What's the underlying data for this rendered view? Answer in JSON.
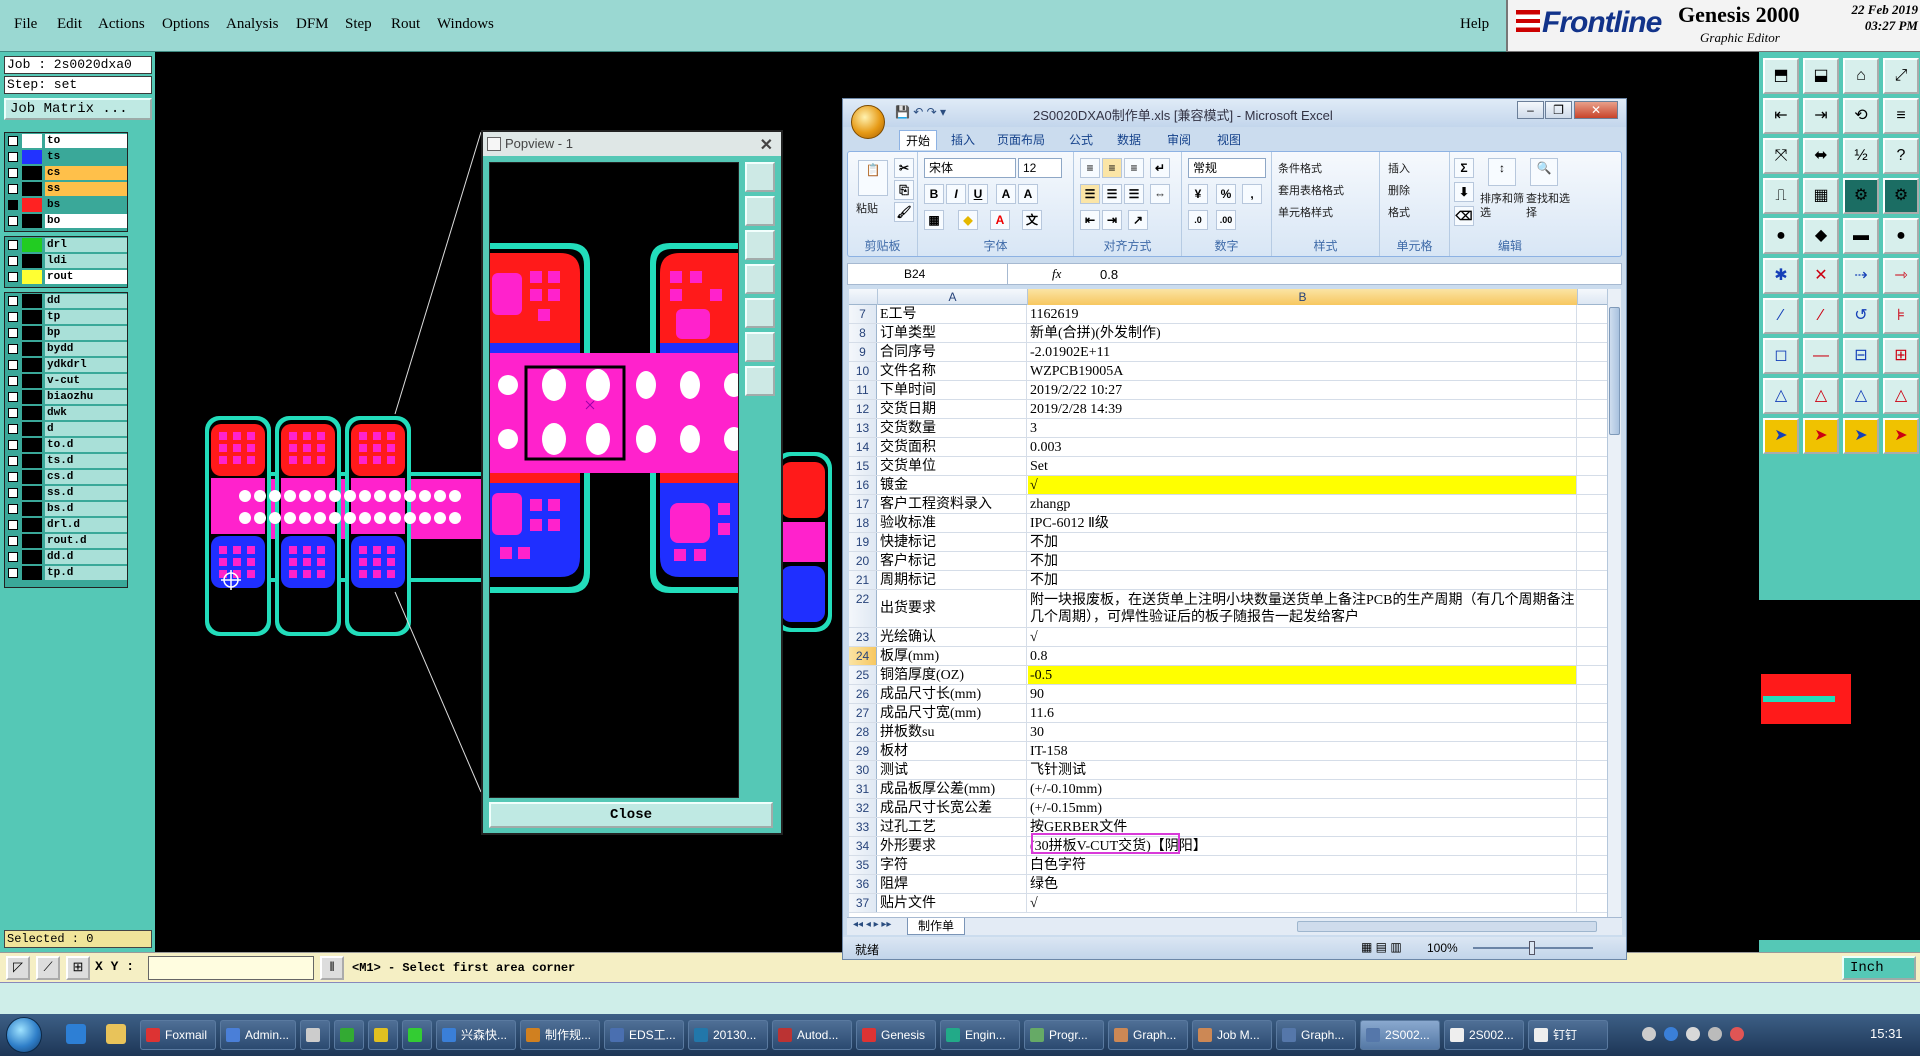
{
  "menubar": {
    "items": [
      "File",
      "Edit",
      "Actions",
      "Options",
      "Analysis",
      "DFM",
      "Step",
      "Rout",
      "Windows"
    ],
    "help": "Help"
  },
  "logo": {
    "brand": "Frontline",
    "product": "Genesis 2000",
    "subtitle": "Graphic Editor",
    "date": "22 Feb 2019",
    "time": "03:27 PM"
  },
  "leftpanel": {
    "job": "Job : 2s0020dxa0",
    "step": "Step: set",
    "job_matrix": "Job Matrix ...",
    "board_layers": [
      {
        "name": "to",
        "color": "#ffffff",
        "checked": false
      },
      {
        "name": "ts",
        "color": "#2233ff",
        "checked": false
      },
      {
        "name": "cs",
        "color": "#000000",
        "checked": false
      },
      {
        "name": "ss",
        "color": "#000000",
        "checked": false
      },
      {
        "name": "bs",
        "color": "#ff2222",
        "checked": true
      },
      {
        "name": "bo",
        "color": "#000000",
        "checked": false
      }
    ],
    "drill_layers": [
      {
        "name": "drl",
        "color": "#22cc22",
        "checked": false
      },
      {
        "name": "ldi",
        "color": "#000000",
        "checked": false
      },
      {
        "name": "rout",
        "color": "#ffff33",
        "checked": false
      }
    ],
    "misc_layers": [
      "dd",
      "tp",
      "bp",
      "bydd",
      "ydkdrl",
      "v-cut",
      "biaozhu",
      "dwk",
      "d",
      "to.d",
      "ts.d",
      "cs.d",
      "ss.d",
      "bs.d",
      "drl.d",
      "rout.d",
      "dd.d",
      "tp.d"
    ],
    "selected": "Selected : 0"
  },
  "popview": {
    "title": "Popview - 1",
    "close": "Close"
  },
  "statusbar": {
    "xy_label": "X Y :",
    "xy_value": "",
    "prompt": "<M1> - Select first area corner",
    "units": "Inch"
  },
  "excel": {
    "title": "2S0020DXA0制作单.xls  [兼容模式] - Microsoft Excel",
    "tabs": [
      "开始",
      "插入",
      "页面布局",
      "公式",
      "数据",
      "审阅",
      "视图"
    ],
    "ribbon": {
      "clipboard": {
        "name": "剪贴板",
        "paste": "粘贴"
      },
      "font": {
        "name": "字体",
        "font_name": "宋体",
        "font_size": "12"
      },
      "alignment": {
        "name": "对齐方式"
      },
      "number": {
        "name": "数字",
        "format": "常规"
      },
      "styles": {
        "name": "样式",
        "items": [
          "条件格式",
          "套用表格格式",
          "单元格样式"
        ]
      },
      "cells": {
        "name": "单元格",
        "items": [
          "插入",
          "删除",
          "格式"
        ]
      },
      "editing": {
        "name": "编辑",
        "sort": "排序和筛选",
        "find": "查找和选择"
      }
    },
    "name_box": "B24",
    "formula": "0.8",
    "columns": [
      "A",
      "B"
    ],
    "rows": [
      {
        "n": "7",
        "a": "E工号",
        "b": "1162619"
      },
      {
        "n": "8",
        "a": "订单类型",
        "b": "新单(合拼)(外发制作)"
      },
      {
        "n": "9",
        "a": "合同序号",
        "b": "-2.01902E+11"
      },
      {
        "n": "10",
        "a": "文件名称",
        "b": "WZPCB19005A"
      },
      {
        "n": "11",
        "a": "下单时间",
        "b": "2019/2/22 10:27"
      },
      {
        "n": "12",
        "a": "交货日期",
        "b": "2019/2/28 14:39"
      },
      {
        "n": "13",
        "a": "交货数量",
        "b": "3"
      },
      {
        "n": "14",
        "a": "交货面积",
        "b": "0.003"
      },
      {
        "n": "15",
        "a": "交货单位",
        "b": "Set"
      },
      {
        "n": "16",
        "a": "镀金",
        "b": "√",
        "yellow": true
      },
      {
        "n": "17",
        "a": "客户工程资料录入",
        "b": "zhangp"
      },
      {
        "n": "18",
        "a": "验收标准",
        "b": "IPC-6012 Ⅱ级"
      },
      {
        "n": "19",
        "a": "快捷标记",
        "b": "不加"
      },
      {
        "n": "20",
        "a": "客户标记",
        "b": "不加"
      },
      {
        "n": "21",
        "a": "周期标记",
        "b": "不加"
      },
      {
        "n": "22",
        "a": "出货要求",
        "b": "附一块报废板，在送货单上注明小块数量送货单上备注PCB的生产周期（有几个周期备注几个周期），可焊性验证后的板子随报告一起发给客户",
        "tall": true
      },
      {
        "n": "23",
        "a": "光绘确认",
        "b": "√"
      },
      {
        "n": "24",
        "a": "板厚(mm)",
        "b": "0.8",
        "selected": true
      },
      {
        "n": "25",
        "a": "铜箔厚度(OZ)",
        "b": "-0.5",
        "yellow": true
      },
      {
        "n": "26",
        "a": "成品尺寸长(mm)",
        "b": "90"
      },
      {
        "n": "27",
        "a": "成品尺寸宽(mm)",
        "b": "11.6"
      },
      {
        "n": "28",
        "a": "拼板数su",
        "b": "30"
      },
      {
        "n": "29",
        "a": "板材",
        "b": "IT-158"
      },
      {
        "n": "30",
        "a": "测试",
        "b": "飞针测试"
      },
      {
        "n": "31",
        "a": "成品板厚公差(mm)",
        "b": "(+/-0.10mm)"
      },
      {
        "n": "32",
        "a": "成品尺寸长宽公差",
        "b": "(+/-0.15mm)"
      },
      {
        "n": "33",
        "a": "过孔工艺",
        "b": "按GERBER文件"
      },
      {
        "n": "34",
        "a": "外形要求",
        "b": "(30拼板V-CUT交货)【阴阳】"
      },
      {
        "n": "35",
        "a": "字符",
        "b": "白色字符"
      },
      {
        "n": "36",
        "a": "阻焊",
        "b": "绿色"
      },
      {
        "n": "37",
        "a": "贴片文件",
        "b": "√"
      }
    ],
    "sheet_tab": "制作单",
    "status": "就绪",
    "zoom": "100%"
  },
  "taskbar": {
    "tasks": [
      "Foxmail",
      "Admin...",
      "",
      "",
      "",
      "",
      "兴森快...",
      "制作规...",
      "EDS工...",
      "20130...",
      "Autod...",
      "Genesis",
      "Engin...",
      "Progr...",
      "Graph...",
      "Job M...",
      "Graph...",
      "2S002...",
      "2S002...",
      "钉钉"
    ],
    "clock": "15:31"
  }
}
